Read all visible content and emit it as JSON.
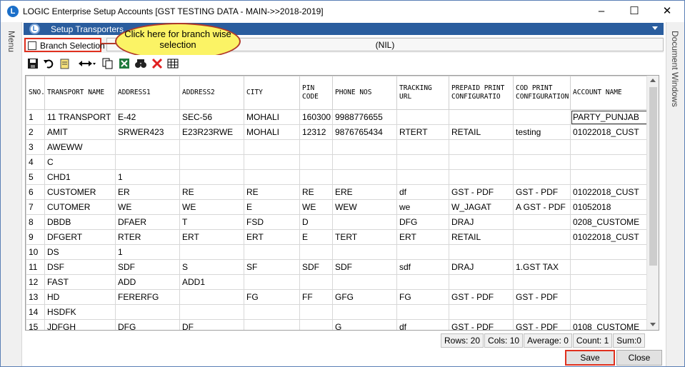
{
  "window": {
    "title": "LOGIC Enterprise Setup Accounts  [GST TESTING DATA - MAIN->>2018-2019]",
    "app_icon": "L",
    "minimize": "–",
    "maximize": "☐",
    "close": "✕"
  },
  "side_rails": {
    "left_label": "Menu",
    "right_label": "Document Windows"
  },
  "inner_tab": {
    "title": "Setup Transporters"
  },
  "branch": {
    "checkbox_label": "Branch Selection",
    "checked": false,
    "nil_value": "(NIL)"
  },
  "callout": {
    "text": "Click here for branch wise selection"
  },
  "toolbar": {
    "icons": [
      "save-icon",
      "undo-icon",
      "notes-icon",
      "move-icon",
      "copy-icon",
      "excel-icon",
      "find-icon",
      "delete-icon",
      "grid-icon"
    ]
  },
  "grid": {
    "headers": [
      "SNO.",
      "TRANSPORT NAME",
      "ADDRESS1",
      "ADDRESS2",
      "CITY",
      "PIN CODE",
      "PHONE NOS",
      "TRACKING URL",
      "PREPAID PRINT CONFIGURATIO",
      "COD PRINT CONFIGURATION",
      "ACCOUNT NAME"
    ],
    "rows": [
      [
        "1",
        "11 TRANSPORT",
        "E-42",
        "SEC-56",
        "MOHALI",
        "160300",
        "9988776655",
        "",
        "",
        "",
        "PARTY_PUNJAB"
      ],
      [
        "2",
        "AMIT",
        "SRWER423",
        "E23R23RWE",
        "MOHALI",
        "12312",
        "9876765434",
        "RTERT",
        "RETAIL",
        "testing",
        "01022018_CUST"
      ],
      [
        "3",
        "AWEWW",
        "",
        "",
        "",
        "",
        "",
        "",
        "",
        "",
        ""
      ],
      [
        "4",
        "C",
        "",
        "",
        "",
        "",
        "",
        "",
        "",
        "",
        ""
      ],
      [
        "5",
        "CHD1",
        "1",
        "",
        "",
        "",
        "",
        "",
        "",
        "",
        ""
      ],
      [
        "6",
        "CUSTOMER",
        "ER",
        "RE",
        "RE",
        "RE",
        "ERE",
        "df",
        "GST - PDF",
        "GST - PDF",
        "01022018_CUST"
      ],
      [
        "7",
        "CUTOMER",
        "WE",
        "WE",
        "E",
        "WE",
        "WEW",
        "we",
        "W_JAGAT",
        "A GST - PDF",
        "01052018"
      ],
      [
        "8",
        "DBDB",
        "DFAER",
        "T",
        "FSD",
        "D",
        "",
        "DFG",
        "DRAJ",
        "",
        "0208_CUSTOME"
      ],
      [
        "9",
        "DFGERT",
        "RTER",
        "ERT",
        "ERT",
        "E",
        "TERT",
        "ERT",
        "RETAIL",
        "",
        "01022018_CUST"
      ],
      [
        "10",
        "DS",
        "1",
        "",
        "",
        "",
        "",
        "",
        "",
        "",
        ""
      ],
      [
        "11",
        "DSF",
        "SDF",
        "S",
        "SF",
        "SDF",
        "SDF",
        "sdf",
        "DRAJ",
        "1.GST TAX",
        ""
      ],
      [
        "12",
        "FAST",
        "ADD",
        "ADD1",
        "",
        "",
        "",
        "",
        "",
        "",
        ""
      ],
      [
        "13",
        "HD",
        "FERERFG",
        "",
        "FG",
        "FF",
        "GFG",
        "FG",
        "GST - PDF",
        "GST - PDF",
        ""
      ],
      [
        "14",
        "HSDFK",
        "",
        "",
        "",
        "",
        "",
        "",
        "",
        "",
        ""
      ],
      [
        "15",
        "JDFGH",
        "DFG",
        "DF",
        "",
        "",
        "G",
        "df",
        "GST - PDF",
        "GST - PDF",
        "0108_CUSTOME"
      ]
    ]
  },
  "status": {
    "rows": "Rows: 20",
    "cols": "Cols: 10",
    "average": "Average: 0",
    "count": "Count: 1",
    "sum": "Sum:0"
  },
  "buttons": {
    "save": "Save",
    "close": "Close"
  }
}
